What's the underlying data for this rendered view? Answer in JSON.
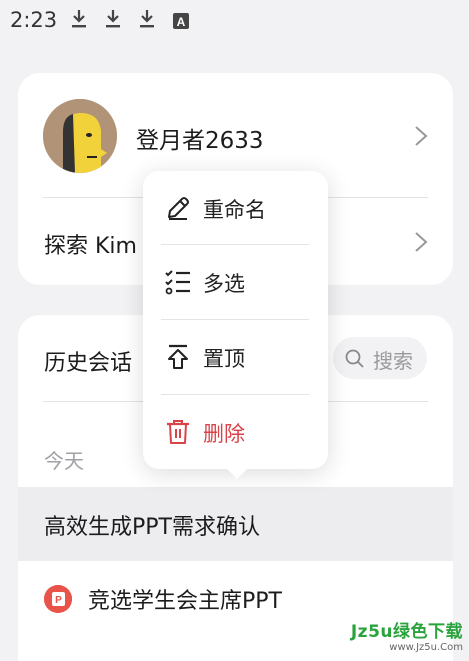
{
  "status_bar": {
    "time": "2:23",
    "icons": [
      "download-icon",
      "download-icon",
      "download-icon",
      "a-icon"
    ]
  },
  "profile": {
    "username": "登月者2633",
    "explore_label": "探索 Kim"
  },
  "history": {
    "title": "历史会话",
    "search_label": "搜索",
    "section_today": "今天",
    "items": [
      {
        "title": "高效生成PPT需求确认"
      },
      {
        "title": "竞选学生会主席PPT"
      }
    ]
  },
  "context_menu": {
    "items": [
      {
        "label": "重命名",
        "icon": "pencil-icon"
      },
      {
        "label": "多选",
        "icon": "checklist-icon"
      },
      {
        "label": "置顶",
        "icon": "pin-top-icon"
      },
      {
        "label": "删除",
        "icon": "trash-icon",
        "color": "#d8434a"
      }
    ]
  },
  "watermark": {
    "main": "Jz5u绿色下载",
    "sub": "www.Jz5u.Com"
  }
}
